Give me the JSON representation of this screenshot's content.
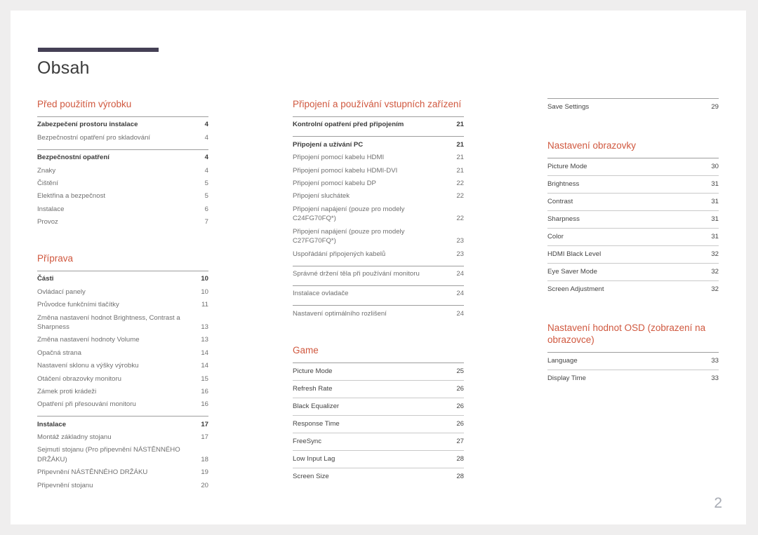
{
  "page": {
    "title": "Obsah",
    "number": "2",
    "accent_color": "#d0583f",
    "rule_color": "#454055"
  },
  "columns": [
    {
      "id": "column-1",
      "sections": [
        {
          "title": "Před použitím výrobku",
          "style": "plain",
          "groups": [
            {
              "rule": "strong",
              "entries": [
                {
                  "label": "Zabezpečení prostoru instalace",
                  "page": "4",
                  "head": true
                },
                {
                  "label": "Bezpečnostní opatření pro skladování",
                  "page": "4",
                  "head": false
                }
              ]
            },
            {
              "rule": "strong",
              "entries": [
                {
                  "label": "Bezpečnostní opatření",
                  "page": "4",
                  "head": true
                },
                {
                  "label": "Znaky",
                  "page": "4",
                  "head": false
                },
                {
                  "label": "Čištění",
                  "page": "5",
                  "head": false
                },
                {
                  "label": "Elektřina a bezpečnost",
                  "page": "5",
                  "head": false
                },
                {
                  "label": "Instalace",
                  "page": "6",
                  "head": false
                },
                {
                  "label": "Provoz",
                  "page": "7",
                  "head": false
                }
              ]
            }
          ]
        },
        {
          "title": "Příprava",
          "style": "plain",
          "spaced": true,
          "groups": [
            {
              "rule": "strong",
              "entries": [
                {
                  "label": "Části",
                  "page": "10",
                  "head": true
                },
                {
                  "label": "Ovládací panely",
                  "page": "10",
                  "head": false
                },
                {
                  "label": "Průvodce funkčními tlačítky",
                  "page": "11",
                  "head": false
                },
                {
                  "label": "Změna nastavení hodnot Brightness, Contrast a Sharpness",
                  "page": "13",
                  "head": false
                },
                {
                  "label": "Změna nastavení hodnoty Volume",
                  "page": "13",
                  "head": false
                },
                {
                  "label": "Opačná strana",
                  "page": "14",
                  "head": false
                },
                {
                  "label": "Nastavení sklonu a výšky výrobku",
                  "page": "14",
                  "head": false
                },
                {
                  "label": "Otáčení obrazovky monitoru",
                  "page": "15",
                  "head": false
                },
                {
                  "label": "Zámek proti krádeži",
                  "page": "16",
                  "head": false
                },
                {
                  "label": "Opatření při přesouvání monitoru",
                  "page": "16",
                  "head": false
                }
              ]
            },
            {
              "rule": "strong",
              "entries": [
                {
                  "label": "Instalace",
                  "page": "17",
                  "head": true
                },
                {
                  "label": "Montáž základny stojanu",
                  "page": "17",
                  "head": false
                },
                {
                  "label": "Sejmutí stojanu (Pro připevnění NÁSTĚNNÉHO DRŽÁKU)",
                  "page": "18",
                  "head": false
                },
                {
                  "label": "Připevnění NÁSTĚNNÉHO DRŽÁKU",
                  "page": "19",
                  "head": false
                },
                {
                  "label": "Připevnění stojanu",
                  "page": "20",
                  "head": false
                }
              ]
            }
          ]
        }
      ]
    },
    {
      "id": "column-2",
      "sections": [
        {
          "title": "Připojení a používání vstupních zařízení",
          "style": "plain",
          "groups": [
            {
              "rule": "strong",
              "entries": [
                {
                  "label": "Kontrolní opatření před připojením",
                  "page": "21",
                  "head": true
                }
              ]
            },
            {
              "rule": "strong",
              "entries": [
                {
                  "label": "Připojení a užívání PC",
                  "page": "21",
                  "head": true
                },
                {
                  "label": "Připojení pomocí kabelu HDMI",
                  "page": "21",
                  "head": false
                },
                {
                  "label": "Připojení pomocí kabelu HDMI-DVI",
                  "page": "21",
                  "head": false
                },
                {
                  "label": "Připojení pomocí kabelu DP",
                  "page": "22",
                  "head": false
                },
                {
                  "label": "Připojení sluchátek",
                  "page": "22",
                  "head": false
                },
                {
                  "label": "Připojení napájení (pouze pro modely C24FG70FQ*)",
                  "page": "22",
                  "head": false
                },
                {
                  "label": "Připojení napájení (pouze pro modely C27FG70FQ*)",
                  "page": "23",
                  "head": false
                },
                {
                  "label": "Uspořádání připojených kabelů",
                  "page": "23",
                  "head": false
                }
              ]
            },
            {
              "rule": "strong",
              "entries": [
                {
                  "label": "Správné držení těla při používání monitoru",
                  "page": "24",
                  "head": false
                }
              ]
            },
            {
              "rule": "strong",
              "entries": [
                {
                  "label": "Instalace ovladače",
                  "page": "24",
                  "head": false
                }
              ]
            },
            {
              "rule": "strong",
              "entries": [
                {
                  "label": "Nastavení optimálního rozlišení",
                  "page": "24",
                  "head": false
                }
              ]
            }
          ]
        },
        {
          "title": "Game",
          "style": "ruled",
          "spaced": true,
          "groups": [
            {
              "rule": "ruled",
              "entries": [
                {
                  "label": "Picture Mode",
                  "page": "25",
                  "head": false
                },
                {
                  "label": "Refresh Rate",
                  "page": "26",
                  "head": false
                },
                {
                  "label": "Black Equalizer",
                  "page": "26",
                  "head": false
                },
                {
                  "label": "Response Time",
                  "page": "26",
                  "head": false
                },
                {
                  "label": "FreeSync",
                  "page": "27",
                  "head": false
                },
                {
                  "label": "Low Input Lag",
                  "page": "28",
                  "head": false
                },
                {
                  "label": "Screen Size",
                  "page": "28",
                  "head": false
                }
              ]
            }
          ]
        }
      ]
    },
    {
      "id": "column-3",
      "sections": [
        {
          "title": "",
          "style": "ruled",
          "groups": [
            {
              "rule": "ruled",
              "entries": [
                {
                  "label": "Save Settings",
                  "page": "29",
                  "head": false
                }
              ]
            }
          ]
        },
        {
          "title": "Nastavení obrazovky",
          "style": "ruled",
          "spaced": true,
          "groups": [
            {
              "rule": "ruled",
              "entries": [
                {
                  "label": "Picture Mode",
                  "page": "30",
                  "head": false
                },
                {
                  "label": "Brightness",
                  "page": "31",
                  "head": false
                },
                {
                  "label": "Contrast",
                  "page": "31",
                  "head": false
                },
                {
                  "label": "Sharpness",
                  "page": "31",
                  "head": false
                },
                {
                  "label": "Color",
                  "page": "31",
                  "head": false
                },
                {
                  "label": "HDMI Black Level",
                  "page": "32",
                  "head": false
                },
                {
                  "label": "Eye Saver Mode",
                  "page": "32",
                  "head": false
                },
                {
                  "label": "Screen Adjustment",
                  "page": "32",
                  "head": false
                }
              ]
            }
          ]
        },
        {
          "title": "Nastavení hodnot OSD (zobrazení na obrazovce)",
          "style": "ruled",
          "spaced": true,
          "groups": [
            {
              "rule": "ruled",
              "entries": [
                {
                  "label": "Language",
                  "page": "33",
                  "head": false
                },
                {
                  "label": "Display Time",
                  "page": "33",
                  "head": false
                }
              ]
            }
          ]
        }
      ]
    }
  ]
}
